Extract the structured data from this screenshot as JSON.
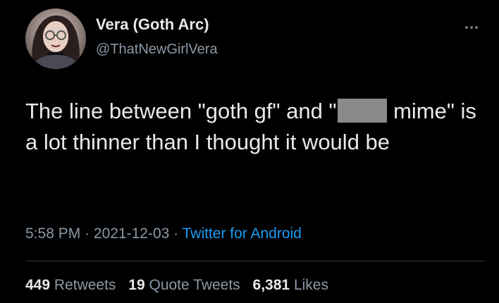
{
  "user": {
    "display_name": "Vera (Goth Arc)",
    "handle": "@ThatNewGirlVera"
  },
  "tweet": {
    "text_part1": "The line between \"goth gf\" and \"",
    "text_part2": " mime\" is a lot thinner than I thought it would be",
    "redacted": true
  },
  "meta": {
    "time": "5:58 PM",
    "separator": " · ",
    "date": "2021-12-03",
    "source": "Twitter for Android"
  },
  "stats": {
    "retweets_count": "449",
    "retweets_label": "Retweets",
    "quotes_count": "19",
    "quotes_label": "Quote Tweets",
    "likes_count": "6,381",
    "likes_label": "Likes"
  },
  "icons": {
    "more": "more-options-icon"
  },
  "colors": {
    "background": "#000000",
    "text": "#e7e9ea",
    "secondary": "#8b98a5",
    "link": "#1d9bf0"
  }
}
